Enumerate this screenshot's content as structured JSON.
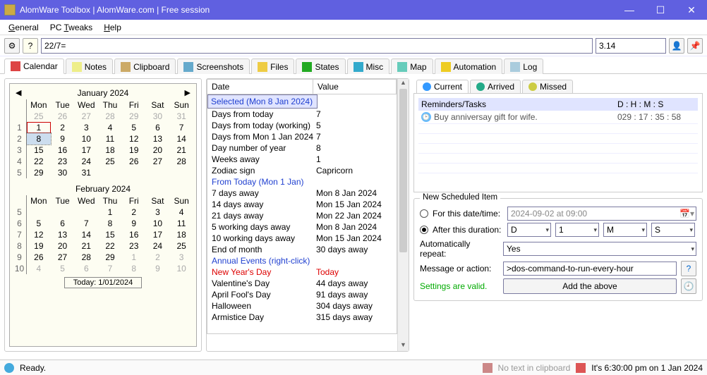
{
  "window": {
    "title": "AlomWare Toolbox  |  AlomWare.com  |  Free session"
  },
  "menu": {
    "general": "General",
    "tweaks": "PC Tweaks",
    "help": "Help"
  },
  "toolbar": {
    "search": "22/7=",
    "result": "3.14"
  },
  "tabs": {
    "calendar": "Calendar",
    "notes": "Notes",
    "clipboard": "Clipboard",
    "screenshots": "Screenshots",
    "files": "Files",
    "states": "States",
    "misc": "Misc",
    "map": "Map",
    "automation": "Automation",
    "log": "Log"
  },
  "cal": {
    "month1": "January 2024",
    "month2": "February 2024",
    "dow": [
      "Mon",
      "Tue",
      "Wed",
      "Thu",
      "Fri",
      "Sat",
      "Sun"
    ],
    "jan_rows": [
      {
        "w": "",
        "d": [
          "25",
          "26",
          "27",
          "28",
          "29",
          "30",
          "31"
        ],
        "gray": true
      },
      {
        "w": "1",
        "d": [
          "1",
          "2",
          "3",
          "4",
          "5",
          "6",
          "7"
        ]
      },
      {
        "w": "2",
        "d": [
          "8",
          "9",
          "10",
          "11",
          "12",
          "13",
          "14"
        ]
      },
      {
        "w": "3",
        "d": [
          "15",
          "16",
          "17",
          "18",
          "19",
          "20",
          "21"
        ]
      },
      {
        "w": "4",
        "d": [
          "22",
          "23",
          "24",
          "25",
          "26",
          "27",
          "28"
        ]
      },
      {
        "w": "5",
        "d": [
          "29",
          "30",
          "31",
          "",
          "",
          "",
          ""
        ]
      }
    ],
    "feb_rows": [
      {
        "w": "5",
        "d": [
          "",
          "",
          "",
          "1",
          "2",
          "3",
          "4"
        ]
      },
      {
        "w": "6",
        "d": [
          "5",
          "6",
          "7",
          "8",
          "9",
          "10",
          "11"
        ]
      },
      {
        "w": "7",
        "d": [
          "12",
          "13",
          "14",
          "15",
          "16",
          "17",
          "18"
        ]
      },
      {
        "w": "8",
        "d": [
          "19",
          "20",
          "21",
          "22",
          "23",
          "24",
          "25"
        ]
      },
      {
        "w": "9",
        "d": [
          "26",
          "27",
          "28",
          "29",
          "1",
          "2",
          "3"
        ],
        "gray_from": 4
      },
      {
        "w": "10",
        "d": [
          "4",
          "5",
          "6",
          "7",
          "8",
          "9",
          "10"
        ],
        "gray": true
      }
    ],
    "today_label": "Today: 1/01/2024"
  },
  "dv": {
    "col_date": "Date",
    "col_value": "Value",
    "rows": [
      {
        "d": "Selected (Mon 8 Jan 2024)",
        "v": "",
        "cls": "header-blue sel"
      },
      {
        "d": "Days from today",
        "v": "7"
      },
      {
        "d": "Days from today (working)",
        "v": "5"
      },
      {
        "d": "Days from Mon 1 Jan 2024",
        "v": "7"
      },
      {
        "d": "Day number of year",
        "v": "8"
      },
      {
        "d": "Weeks away",
        "v": "1"
      },
      {
        "d": "Zodiac sign",
        "v": "Capricorn"
      },
      {
        "d": "From Today (Mon 1 Jan)",
        "v": "",
        "cls": "header-blue"
      },
      {
        "d": "7 days away",
        "v": "Mon 8 Jan 2024"
      },
      {
        "d": "14 days away",
        "v": "Mon 15 Jan 2024"
      },
      {
        "d": "21 days away",
        "v": "Mon 22 Jan 2024"
      },
      {
        "d": "5 working days away",
        "v": "Mon 8 Jan 2024"
      },
      {
        "d": "10 working days away",
        "v": "Mon 15 Jan 2024"
      },
      {
        "d": "End of month",
        "v": "30 days away"
      },
      {
        "d": "Annual Events (right-click)",
        "v": "",
        "cls": "header-blue"
      },
      {
        "d": "New Year's Day",
        "v": "Today",
        "cls": "header-red"
      },
      {
        "d": "Valentine's Day",
        "v": "44 days away"
      },
      {
        "d": "April Fool's Day",
        "v": "91 days away"
      },
      {
        "d": "Halloween",
        "v": "304 days away"
      },
      {
        "d": "Armistice Day",
        "v": "315 days away"
      }
    ]
  },
  "subtabs": {
    "current": "Current",
    "arrived": "Arrived",
    "missed": "Missed"
  },
  "reminders": {
    "header1": "Reminders/Tasks",
    "header2": "D : H : M : S",
    "items": [
      {
        "text": "Buy anniversay gift for wife.",
        "time": "029 : 17 : 35 : 58"
      }
    ]
  },
  "sched": {
    "legend": "New Scheduled Item",
    "for_date": "For this date/time:",
    "date_value": "2024-09-02 at 09:00",
    "after": "After this duration:",
    "d": "D",
    "one": "1",
    "m": "M",
    "s": "S",
    "repeat": "Automatically repeat:",
    "repeat_val": "Yes",
    "msg": "Message or action:",
    "msg_val": ">dos-command-to-run-every-hour",
    "valid": "Settings are valid.",
    "add": "Add the above"
  },
  "status": {
    "ready": "Ready.",
    "noclip": "No text in clipboard",
    "time": "It's 6:30:00 pm on 1 Jan 2024"
  }
}
